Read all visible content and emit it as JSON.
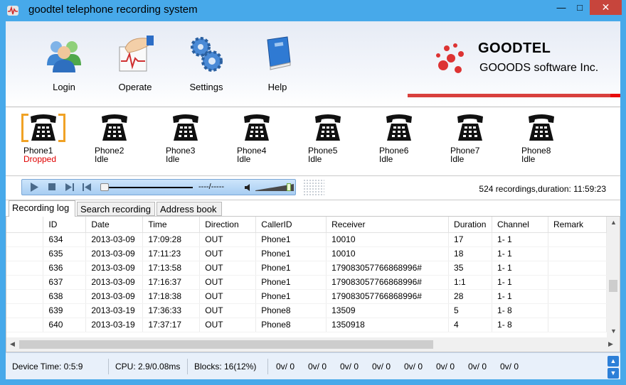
{
  "window": {
    "title": "goodtel telephone recording system",
    "min": "—",
    "max": "□",
    "close": "✕"
  },
  "toolbar": {
    "items": [
      {
        "label": "Login",
        "icon": "login-users-icon"
      },
      {
        "label": "Operate",
        "icon": "operate-hand-icon"
      },
      {
        "label": "Settings",
        "icon": "settings-gears-icon"
      },
      {
        "label": "Help",
        "icon": "help-book-icon"
      }
    ]
  },
  "brand": {
    "name": "GOODTEL",
    "sub": "GOOODS software Inc.",
    "accent_color": "#d9403d"
  },
  "phones": [
    {
      "name": "Phone1",
      "status": "Dropped",
      "status_color": "#e00000"
    },
    {
      "name": "Phone2",
      "status": "Idle"
    },
    {
      "name": "Phone3",
      "status": "Idle"
    },
    {
      "name": "Phone4",
      "status": "Idle"
    },
    {
      "name": "Phone5",
      "status": "Idle"
    },
    {
      "name": "Phone6",
      "status": "Idle"
    },
    {
      "name": "Phone7",
      "status": "Idle"
    },
    {
      "name": "Phone8",
      "status": "Idle"
    }
  ],
  "player": {
    "time": "----/-----",
    "summary": "524 recordings,duration: 11:59:23"
  },
  "tabs": [
    "Recording log",
    "Search recording",
    "Address book"
  ],
  "grid": {
    "columns": [
      "",
      "ID",
      "Date",
      "Time",
      "Direction",
      "CallerID",
      "Receiver",
      "Duration",
      "Channel",
      "Remark"
    ],
    "rows": [
      [
        "634",
        "2013-03-09",
        "17:09:28",
        "OUT",
        "Phone1",
        "10010",
        "17",
        "1- 1",
        ""
      ],
      [
        "635",
        "2013-03-09",
        "17:11:23",
        "OUT",
        "Phone1",
        "10010",
        "18",
        "1- 1",
        ""
      ],
      [
        "636",
        "2013-03-09",
        "17:13:58",
        "OUT",
        "Phone1",
        "17908305776686899​6#",
        "35",
        "1- 1",
        ""
      ],
      [
        "637",
        "2013-03-09",
        "17:16:37",
        "OUT",
        "Phone1",
        "17908305776686899​6#",
        "1:1",
        "1- 1",
        ""
      ],
      [
        "638",
        "2013-03-09",
        "17:18:38",
        "OUT",
        "Phone1",
        "17908305776686899​6#",
        "28",
        "1- 1",
        ""
      ],
      [
        "639",
        "2013-03-19",
        "17:36:33",
        "OUT",
        "Phone8",
        "13509",
        "5",
        "1- 8",
        ""
      ],
      [
        "640",
        "2013-03-19",
        "17:37:17",
        "OUT",
        "Phone8",
        "1350918",
        "4",
        "1- 8",
        ""
      ]
    ]
  },
  "status": {
    "device_time": "Device Time: 0:5:9",
    "cpu": "CPU: 2.9/0.08ms",
    "blocks": "Blocks: 16(12%)",
    "channels": [
      "0v/  0",
      "0v/  0",
      "0v/  0",
      "0v/  0",
      "0v/  0",
      "0v/  0",
      "0v/  0",
      "0v/  0"
    ]
  }
}
